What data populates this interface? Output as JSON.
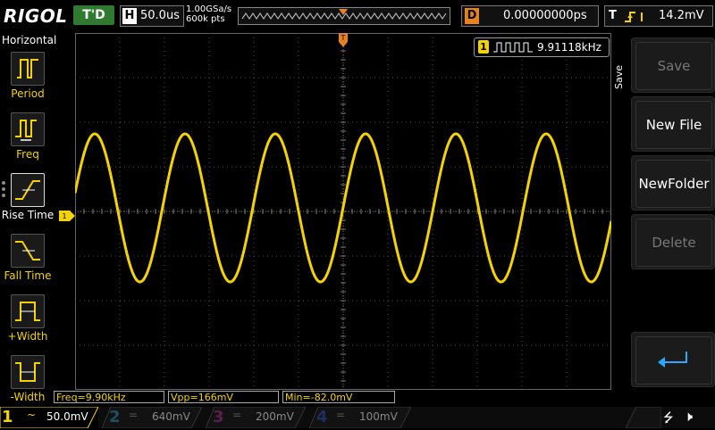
{
  "topbar": {
    "brand": "RIGOL",
    "trigger_status": "T'D",
    "horizontal_label": "H",
    "timebase": "50.0us",
    "sample_rate": "1.00GSa/s",
    "memory_depth": "600k pts",
    "delay_label": "D",
    "delay_value": "0.00000000ps",
    "trigger_label": "T",
    "trigger_level": "14.2mV"
  },
  "left_menu": {
    "title": "Horizontal",
    "items": [
      {
        "label": "Period",
        "icon": "period-measure-icon"
      },
      {
        "label": "Freq",
        "icon": "frequency-measure-icon"
      },
      {
        "label": "Rise Time",
        "icon": "rise-time-icon"
      },
      {
        "label": "Fall Time",
        "icon": "fall-time-icon"
      },
      {
        "label": "+Width",
        "icon": "positive-width-icon"
      },
      {
        "label": "-Width",
        "icon": "negative-width-icon"
      }
    ]
  },
  "right_menu": {
    "title": "Save",
    "keys": [
      {
        "label": "Save",
        "enabled": false
      },
      {
        "label": "New File",
        "enabled": true
      },
      {
        "label": "NewFolder",
        "enabled": true
      },
      {
        "label": "Delete",
        "enabled": false
      }
    ],
    "back_icon": "return-arrow-icon"
  },
  "counter": {
    "channel": "1",
    "value": "9.91118kHz"
  },
  "measurements": {
    "freq": "Freq=9.90kHz",
    "vpp": "Vpp=166mV",
    "min": "Min=-82.0mV"
  },
  "channels": [
    {
      "num": "1",
      "scale": "50.0mV",
      "color": "#f5d300",
      "active": true,
      "coupling": "~"
    },
    {
      "num": "2",
      "scale": "640mV",
      "color": "#00c8ff",
      "active": false,
      "coupling": "="
    },
    {
      "num": "3",
      "scale": "200mV",
      "color": "#ff33cc",
      "active": false,
      "coupling": "="
    },
    {
      "num": "4",
      "scale": "100mV",
      "color": "#2a6fff",
      "active": false,
      "coupling": "="
    }
  ],
  "waveform": {
    "channel": "1",
    "color": "#f5d300",
    "frequency_khz": 9.9,
    "vpp_mv": 166,
    "min_mv": -82.0
  },
  "colors": {
    "ch1": "#f5d300",
    "trigger": "#e8821e",
    "grid": "#4a4a4a"
  }
}
